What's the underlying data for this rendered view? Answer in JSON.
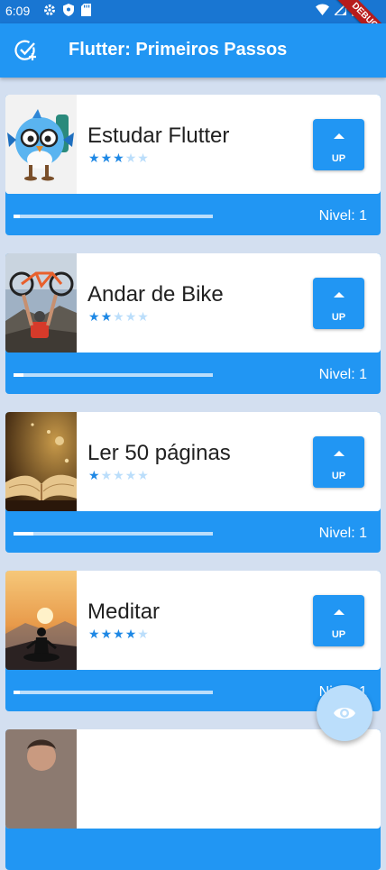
{
  "status": {
    "time": "6:09"
  },
  "debug_label": "DEBUG",
  "appbar": {
    "title": "Flutter: Primeiros Passos",
    "icon": "task-add-icon"
  },
  "tasks": [
    {
      "name": "Estudar Flutter",
      "difficulty": 3,
      "level_text": "Nivel: 1",
      "up_label": "UP",
      "progress": 0.03,
      "image": "blue-bird-mascot"
    },
    {
      "name": "Andar de Bike",
      "difficulty": 2,
      "level_text": "Nivel: 1",
      "up_label": "UP",
      "progress": 0.05,
      "image": "person-holding-bike"
    },
    {
      "name": "Ler 50 páginas",
      "difficulty": 1,
      "level_text": "Nivel: 1",
      "up_label": "UP",
      "progress": 0.1,
      "image": "open-book"
    },
    {
      "name": "Meditar",
      "difficulty": 4,
      "level_text": "Nivel: 1",
      "up_label": "UP",
      "progress": 0.03,
      "image": "meditation-silhouette"
    },
    {
      "name": "",
      "difficulty": 0,
      "level_text": "",
      "up_label": "",
      "progress": 0,
      "image": "portrait-photo"
    }
  ],
  "fab": {
    "icon": "eye-icon"
  },
  "colors": {
    "primary": "#2196f3",
    "status_bar": "#1976d2",
    "background": "#d3dff0",
    "star_on": "#1e88e5",
    "star_off": "#bbdefb"
  }
}
